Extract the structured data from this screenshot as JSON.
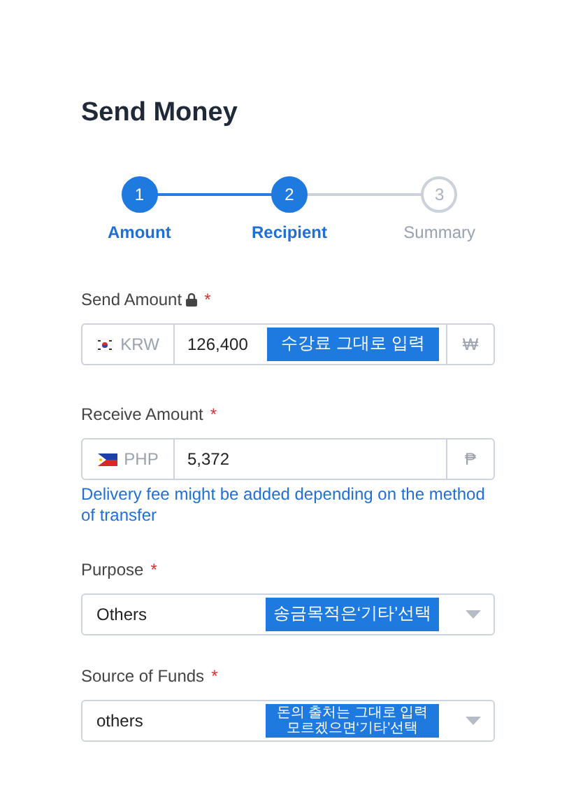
{
  "title": "Send Money",
  "steps": [
    {
      "number": "1",
      "label": "Amount",
      "active": true
    },
    {
      "number": "2",
      "label": "Recipient",
      "active": true
    },
    {
      "number": "3",
      "label": "Summary",
      "active": false
    }
  ],
  "amount_fields": [
    {
      "label": "Send Amount",
      "locked": true,
      "required_mark": "*",
      "flag": {
        "kind": "kr"
      },
      "currency": "KRW",
      "value": "126,400",
      "symbol": "₩",
      "annotation": [
        "수강료 그대로 입력"
      ]
    },
    {
      "label": "Receive Amount",
      "locked": false,
      "required_mark": "*",
      "flag": {
        "kind": "ph"
      },
      "currency": "PHP",
      "value": "5,372",
      "symbol": "₱",
      "note": "Delivery fee might be added depending on the method of transfer"
    }
  ],
  "select_fields": [
    {
      "label": "Purpose",
      "required_mark": "*",
      "value": "Others",
      "annotation": [
        "송금목적은‘기타’선택"
      ]
    },
    {
      "label": "Source of Funds",
      "required_mark": "*",
      "value": "others",
      "annotation": [
        "돈의 출처는 그대로 입력",
        "모르겠으면‘기타’선택"
      ]
    }
  ]
}
